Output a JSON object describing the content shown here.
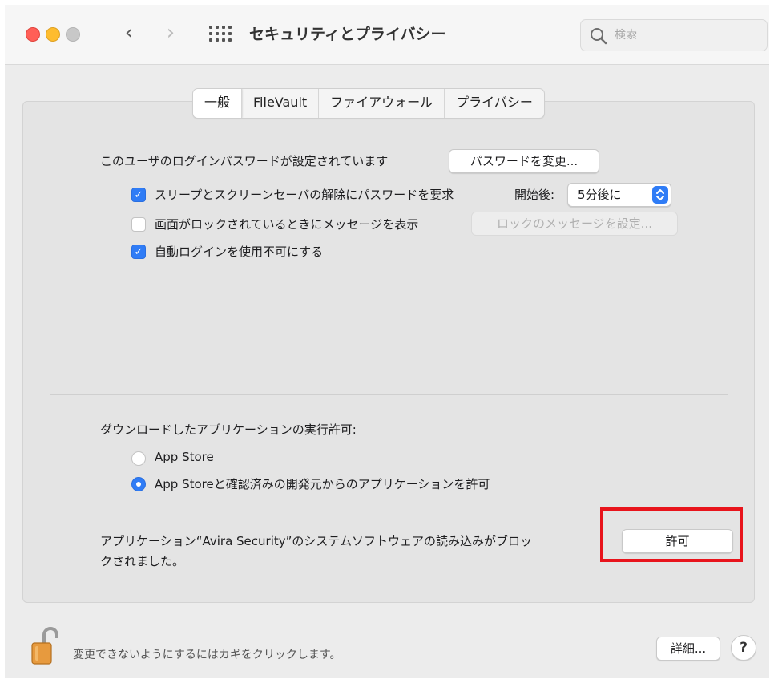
{
  "window": {
    "title": "セキュリティとプライバシー",
    "search_placeholder": "検索"
  },
  "tabs": [
    "一般",
    "FileVault",
    "ファイアウォール",
    "プライバシー"
  ],
  "active_tab": "一般",
  "general": {
    "password_label": "このユーザのログインパスワードが設定されています",
    "change_password_button": "パスワードを変更...",
    "require_password": {
      "label": "スリープとスクリーンセーバの解除にパスワードを要求",
      "checked": true,
      "delay_label": "開始後:",
      "delay_value": "5分後に"
    },
    "lock_message": {
      "label": "画面がロックされているときにメッセージを表示",
      "checked": false,
      "button": "ロックのメッセージを設定..."
    },
    "disable_autologin": {
      "label": "自動ログインを使用不可にする",
      "checked": true
    }
  },
  "downloads": {
    "heading": "ダウンロードしたアプリケーションの実行許可:",
    "options": [
      {
        "label": "App Store",
        "selected": false
      },
      {
        "label": "App Storeと確認済みの開発元からのアプリケーションを許可",
        "selected": true
      }
    ]
  },
  "blocked": {
    "message_line1": "アプリケーション“Avira Security”のシステムソフトウェアの読み込みがブロッ",
    "message_line2": "クされました。",
    "allow_button": "許可"
  },
  "footer": {
    "lock_text": "変更できないようにするにはカギをクリックします。",
    "advanced_button": "詳細...",
    "help_button": "?"
  },
  "colors": {
    "accent": "#2f7cf6",
    "highlight_box": "#e8141c"
  }
}
